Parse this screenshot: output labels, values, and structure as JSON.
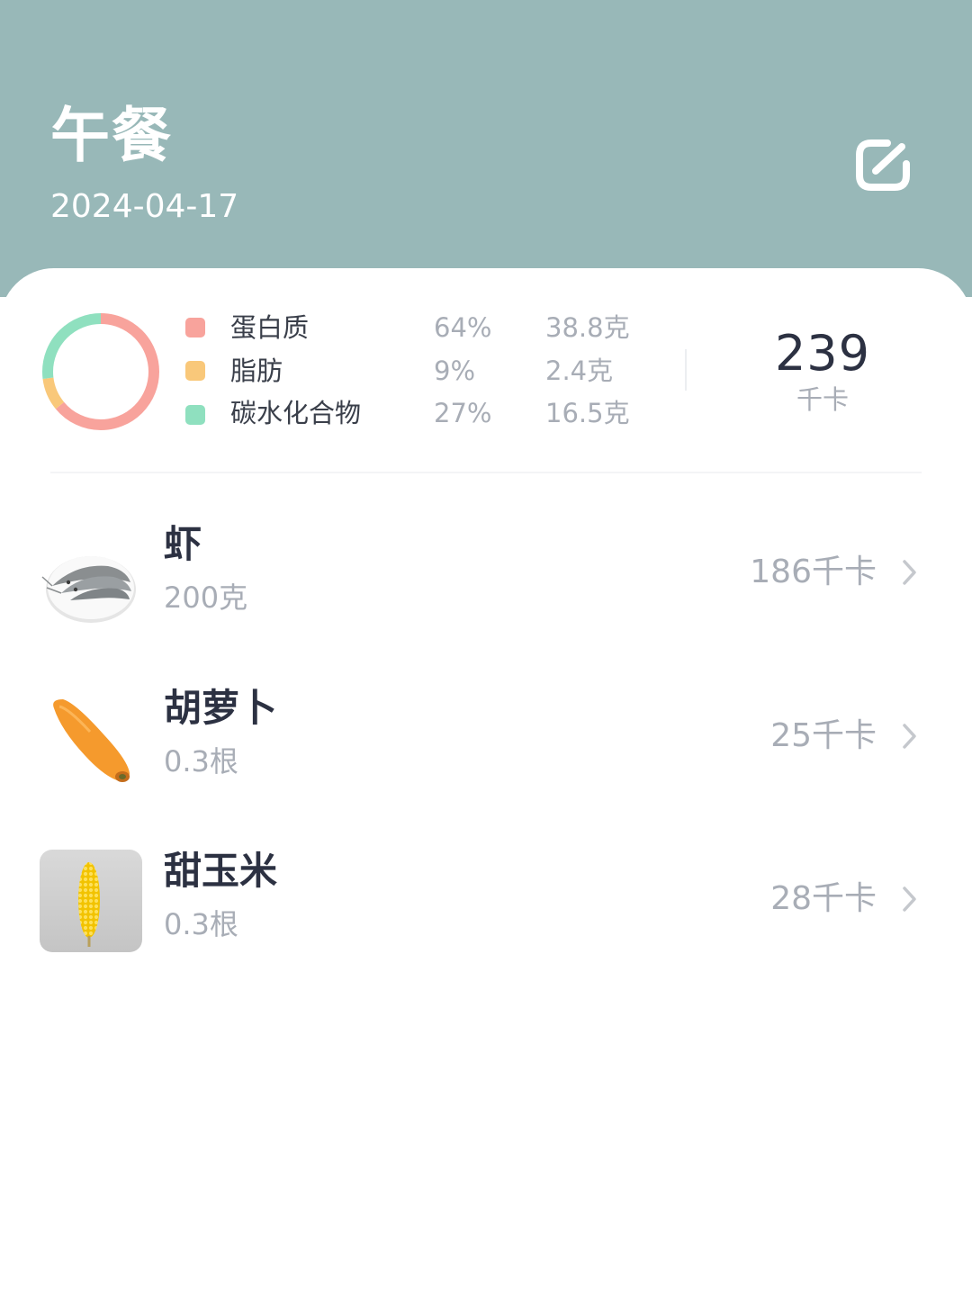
{
  "header": {
    "title": "午餐",
    "date": "2024-04-17",
    "edit_icon": "edit-icon"
  },
  "colors": {
    "header_bg": "#98b8b8",
    "protein": "#f8a39c",
    "fat": "#f9c87a",
    "carbs": "#8fe0bf"
  },
  "nutrition": {
    "items": [
      {
        "name": "蛋白质",
        "percent": "64%",
        "grams": "38.8克",
        "color": "#f8a39c"
      },
      {
        "name": "脂肪",
        "percent": "9%",
        "grams": "2.4克",
        "color": "#f9c87a"
      },
      {
        "name": "碳水化合物",
        "percent": "27%",
        "grams": "16.5克",
        "color": "#8fe0bf"
      }
    ],
    "total": "239",
    "total_unit": "千卡"
  },
  "foods": [
    {
      "name": "虾",
      "amount": "200克",
      "kcal": "186千卡",
      "icon": "shrimp-image"
    },
    {
      "name": "胡萝卜",
      "amount": "0.3根",
      "kcal": "25千卡",
      "icon": "carrot-image"
    },
    {
      "name": "甜玉米",
      "amount": "0.3根",
      "kcal": "28千卡",
      "icon": "corn-image"
    }
  ]
}
